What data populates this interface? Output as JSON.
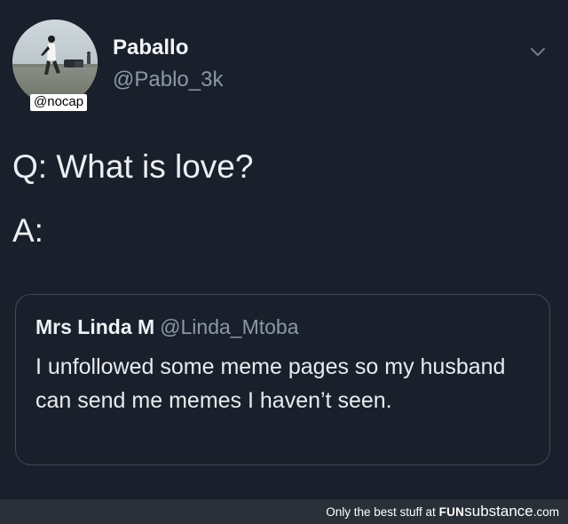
{
  "tweet": {
    "display_name": "Paballo",
    "handle": "@Pablo_3k",
    "avatar_tag": "@nocap",
    "line_q": "Q: What is love?",
    "line_a": "A:",
    "quoted": {
      "name": "Mrs Linda  M",
      "handle": "@Linda_Mtoba",
      "body": "I unfollowed some meme pages so my husband can send me memes I haven’t seen."
    }
  },
  "footer": {
    "text": "Only the best stuff at",
    "brand_fun": "FUN",
    "brand_sub": "substance",
    "brand_tld": ".com"
  },
  "icons": {
    "menu": "chevron-down-icon"
  },
  "colors": {
    "background": "#1a202b",
    "secondary_text": "#8a98a6",
    "card_border": "#3d4a57",
    "footer_bg": "#2a3038"
  }
}
